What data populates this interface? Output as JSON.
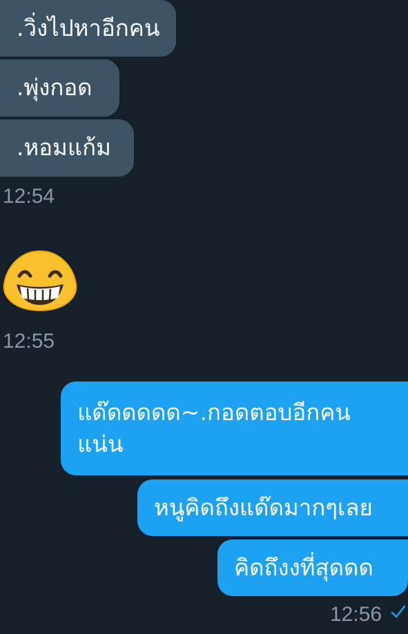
{
  "incoming": [
    {
      "text": ".วิ่งไปหาอีกคน"
    },
    {
      "text": ".พุ่งกอด"
    },
    {
      "text": ".หอมแก้ม"
    }
  ],
  "incoming_time": "12:54",
  "emoji": {
    "icon": "grinning-face-emoji",
    "time": "12:55"
  },
  "outgoing": [
    {
      "line1": "แด๊ดดดดด~.กอดตอบอีกคน",
      "line2": "แน่น"
    },
    {
      "text": "หนูคิดถึงแด๊ดมากๆเลย"
    },
    {
      "text": "คิดถึงงที่สุดดด"
    }
  ],
  "outgoing_time": "12:56",
  "read_status_icon": "checkmark-icon",
  "colors": {
    "background": "#15202b",
    "incoming_bubble": "#3d5466",
    "outgoing_bubble": "#1da1f2",
    "timestamp": "#8899a6",
    "check": "#1da1f2"
  }
}
